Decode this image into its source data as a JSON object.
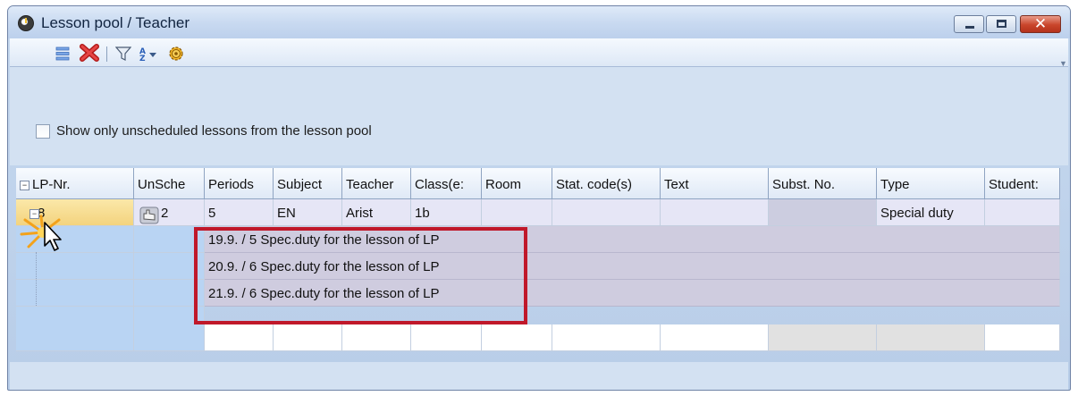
{
  "window": {
    "title": "Lesson pool / Teacher",
    "icons": [
      "app-clock-icon",
      "minimize-icon",
      "maximize-icon",
      "close-icon"
    ]
  },
  "toolbar": {
    "icons": [
      "list-view-icon",
      "delete-icon",
      "filter-icon",
      "sort-icon",
      "settings-gear-icon"
    ]
  },
  "options": {
    "show_unscheduled_label": "Show only unscheduled lessons from the lesson pool",
    "show_unscheduled_checked": false
  },
  "grid": {
    "columns": [
      "LP-Nr.",
      "UnSche",
      "Periods",
      "Subject",
      "Teacher",
      "Class(e:",
      "Room",
      "Stat. code(s)",
      "Text",
      "Subst. No.",
      "Type",
      "Student:"
    ],
    "lesson_row": {
      "lp_nr": "8",
      "unscheduled": "2",
      "periods": "5",
      "subject": "EN",
      "teacher": "Arist",
      "class": "1b",
      "room": "",
      "stat_code": "",
      "text": "",
      "subst_no": "",
      "type": "Special duty",
      "students": ""
    },
    "sub_rows": [
      "19.9. / 5 Spec.duty for the lesson of LP",
      "20.9. / 6 Spec.duty for the lesson of LP",
      "21.9. / 6 Spec.duty for the lesson of LP"
    ]
  },
  "colors": {
    "highlight_border": "#c0182a",
    "selection_fill": "#f3d37e",
    "lp_column": "#b9d4f3"
  }
}
